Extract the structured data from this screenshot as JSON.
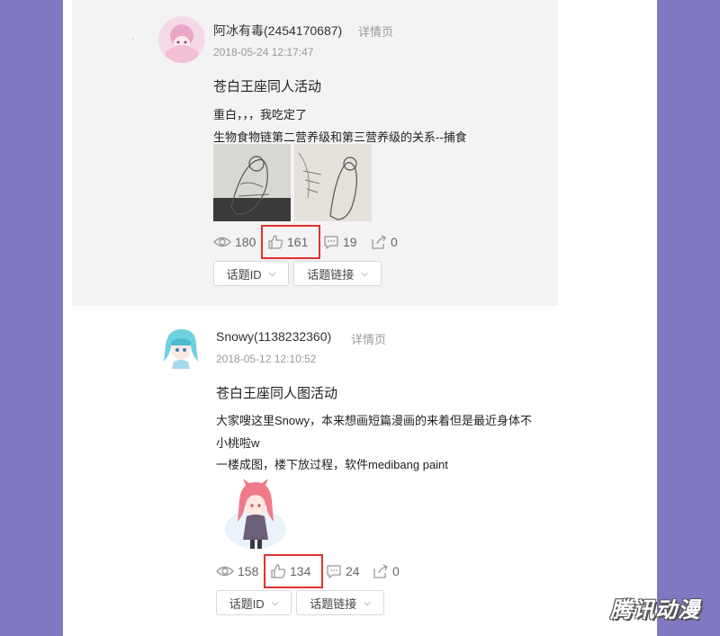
{
  "posts": [
    {
      "author": "阿冰有毒(2454170687)",
      "detail": "详情页",
      "time": "2018-05-24 12:17:47",
      "title": "苍白王座同人活动",
      "lines": [
        "重白，，，我吃定了",
        "生物食物链第二营养级和第三营养级的关系--捕食"
      ],
      "views": "180",
      "likes": "161",
      "comments": "19",
      "shares": "0",
      "tag_id": "话题ID",
      "tag_link": "话题链接"
    },
    {
      "author": "Snowy(1138232360)",
      "detail": "详情页",
      "time": "2018-05-12 12:10:52",
      "title": "苍白王座同人图活动",
      "lines": [
        "大家嗖这里Snowy，本来想画短篇漫画的来着但是最近身体不",
        "小桃啦w",
        "一楼成图，楼下放过程，软件medibang paint"
      ],
      "views": "158",
      "likes": "134",
      "comments": "24",
      "shares": "0",
      "tag_id": "话题ID",
      "tag_link": "话题链接"
    }
  ],
  "watermark": "腾讯动漫",
  "colors": {
    "background": "#8178c2",
    "highlight": "#e0322f",
    "card": "#f3f3f3"
  }
}
